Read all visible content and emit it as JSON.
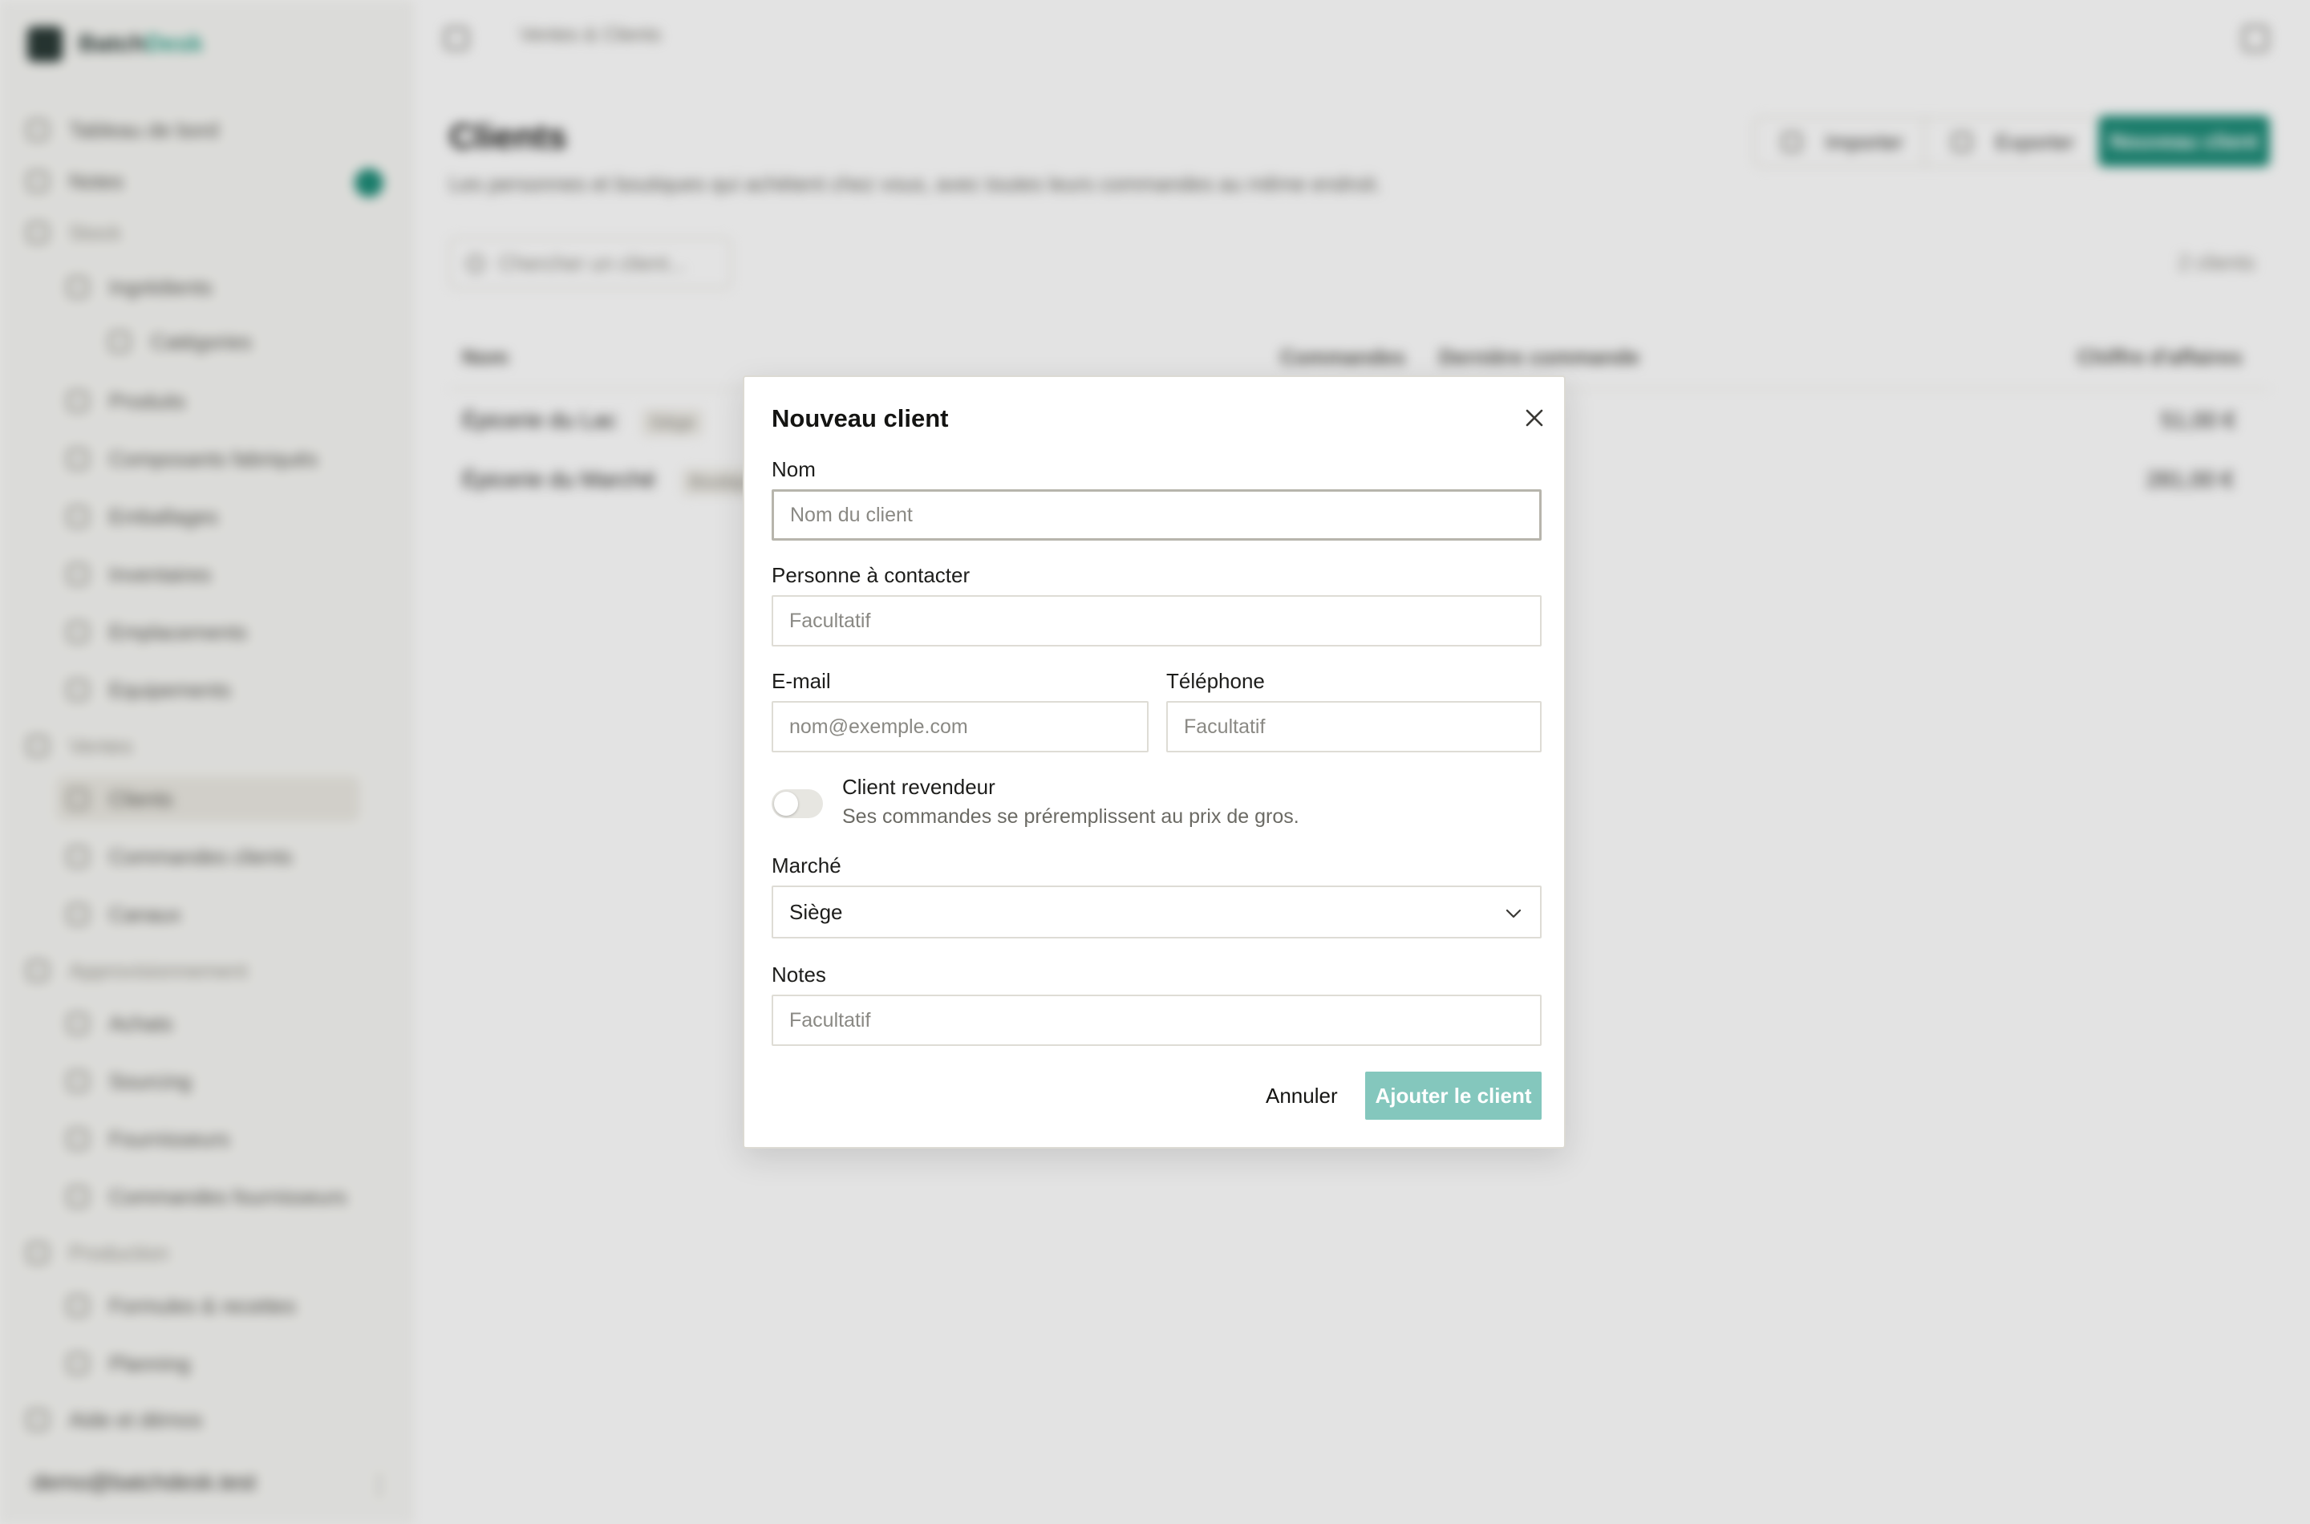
{
  "app": {
    "brand_part1": "Batch",
    "brand_part2": "Desk",
    "breadcrumb": "Ventes & Clients",
    "user_email": "demo@batchdesk.test"
  },
  "sidebar": {
    "items": [
      {
        "label": "Tableau de bord"
      },
      {
        "label": "Notes"
      },
      {
        "label": "Stock"
      },
      {
        "label": "Ingrédients"
      },
      {
        "label": "Catégories"
      },
      {
        "label": "Produits"
      },
      {
        "label": "Composants fabriqués"
      },
      {
        "label": "Emballages"
      },
      {
        "label": "Inventaires"
      },
      {
        "label": "Emplacements"
      },
      {
        "label": "Equipements"
      },
      {
        "label": "Ventes"
      },
      {
        "label": "Clients"
      },
      {
        "label": "Commandes clients"
      },
      {
        "label": "Canaux"
      },
      {
        "label": "Approvisionnement"
      },
      {
        "label": "Achats"
      },
      {
        "label": "Sourcing"
      },
      {
        "label": "Fournisseurs"
      },
      {
        "label": "Commandes fournisseurs"
      },
      {
        "label": "Production"
      },
      {
        "label": "Formules & recettes"
      },
      {
        "label": "Planning"
      },
      {
        "label": "Aide et démos"
      }
    ]
  },
  "page": {
    "title": "Clients",
    "subtitle": "Les personnes et boutiques qui achètent chez vous, avec toutes leurs commandes au même endroit.",
    "import_label": "Importer",
    "export_label": "Exporter",
    "new_client_label": "Nouveau client",
    "search_placeholder": "Chercher un client...",
    "count_label": "2 clients"
  },
  "table": {
    "headers": {
      "name": "Nom",
      "orders": "Commandes",
      "last_order": "Dernière commande",
      "revenue": "Chiffre d'affaires"
    },
    "rows": [
      {
        "name": "Épicerie du Lac",
        "tag": "Siège",
        "revenue": "51,00 €"
      },
      {
        "name": "Épicerie du Marché",
        "tag": "Boutique",
        "revenue": "281,00 €"
      }
    ]
  },
  "modal": {
    "title": "Nouveau client",
    "name_label": "Nom",
    "name_placeholder": "Nom du client",
    "contact_label": "Personne à contacter",
    "contact_placeholder": "Facultatif",
    "email_label": "E-mail",
    "email_placeholder": "nom@exemple.com",
    "phone_label": "Téléphone",
    "phone_placeholder": "Facultatif",
    "reseller_label": "Client revendeur",
    "reseller_desc": "Ses commandes se préremplissent au prix de gros.",
    "reseller_on": false,
    "market_label": "Marché",
    "market_value": "Siège",
    "notes_label": "Notes",
    "notes_placeholder": "Facultatif",
    "cancel_label": "Annuler",
    "submit_label": "Ajouter le client"
  },
  "colors": {
    "accent": "#1e8c78",
    "accent_disabled": "#84c7bd",
    "overlay": "rgba(0,0,0,0.11)"
  },
  "icons": {
    "close": "close-icon",
    "chevron": "chevron-down-icon",
    "search": "search-icon"
  }
}
